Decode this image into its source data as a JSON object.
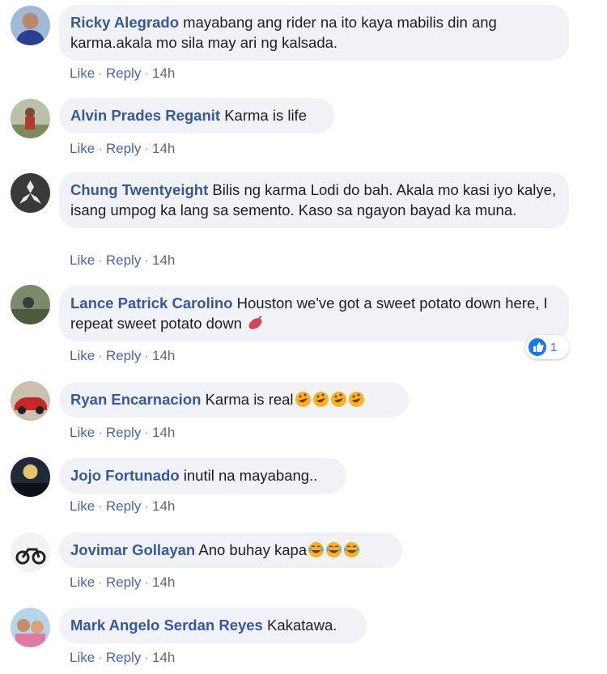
{
  "actions": {
    "like": "Like",
    "reply": "Reply",
    "sep": "·"
  },
  "colors": {
    "author": "#385898",
    "bubble": "#f0f2f5",
    "link": "#4b67a1",
    "like_blue": "#1877f2"
  },
  "comments": [
    {
      "author": "Ricky Alegrado",
      "text": "mayabang ang rider na ito kaya mabilis din ang karma.akala mo sila may ari ng kalsada.",
      "time": "14h"
    },
    {
      "author": "Alvin Prades Reganit",
      "text": "Karma is life",
      "time": "14h"
    },
    {
      "author": "Chung Twentyeight",
      "text": "Bilis ng karma Lodi do bah. Akala mo kasi iyo kalye, isang umpog ka lang sa semento. Kaso sa ngayon bayad ka muna.",
      "time": "14h"
    },
    {
      "author": "Lance Patrick Carolino",
      "text": "Houston we've got a sweet potato down here, I repeat sweet potato down",
      "time": "14h",
      "emoji": "sweet-potato-icon",
      "reaction": {
        "icon": "like-icon",
        "count": "1"
      }
    },
    {
      "author": "Ryan Encarnacion",
      "text": "Karma is real",
      "time": "14h",
      "emoji": "rofl-emoji",
      "emoji_count": 4
    },
    {
      "author": "Jojo Fortunado",
      "text": "inutil na mayabang..",
      "time": "14h"
    },
    {
      "author": "Jovimar Gollayan",
      "text": "Ano buhay kapa",
      "time": "14h",
      "emoji": "tears-of-joy-emoji",
      "emoji_count": 3
    },
    {
      "author": "Mark Angelo Serdan Reyes",
      "text": "Kakatawa.",
      "time": "14h"
    }
  ]
}
